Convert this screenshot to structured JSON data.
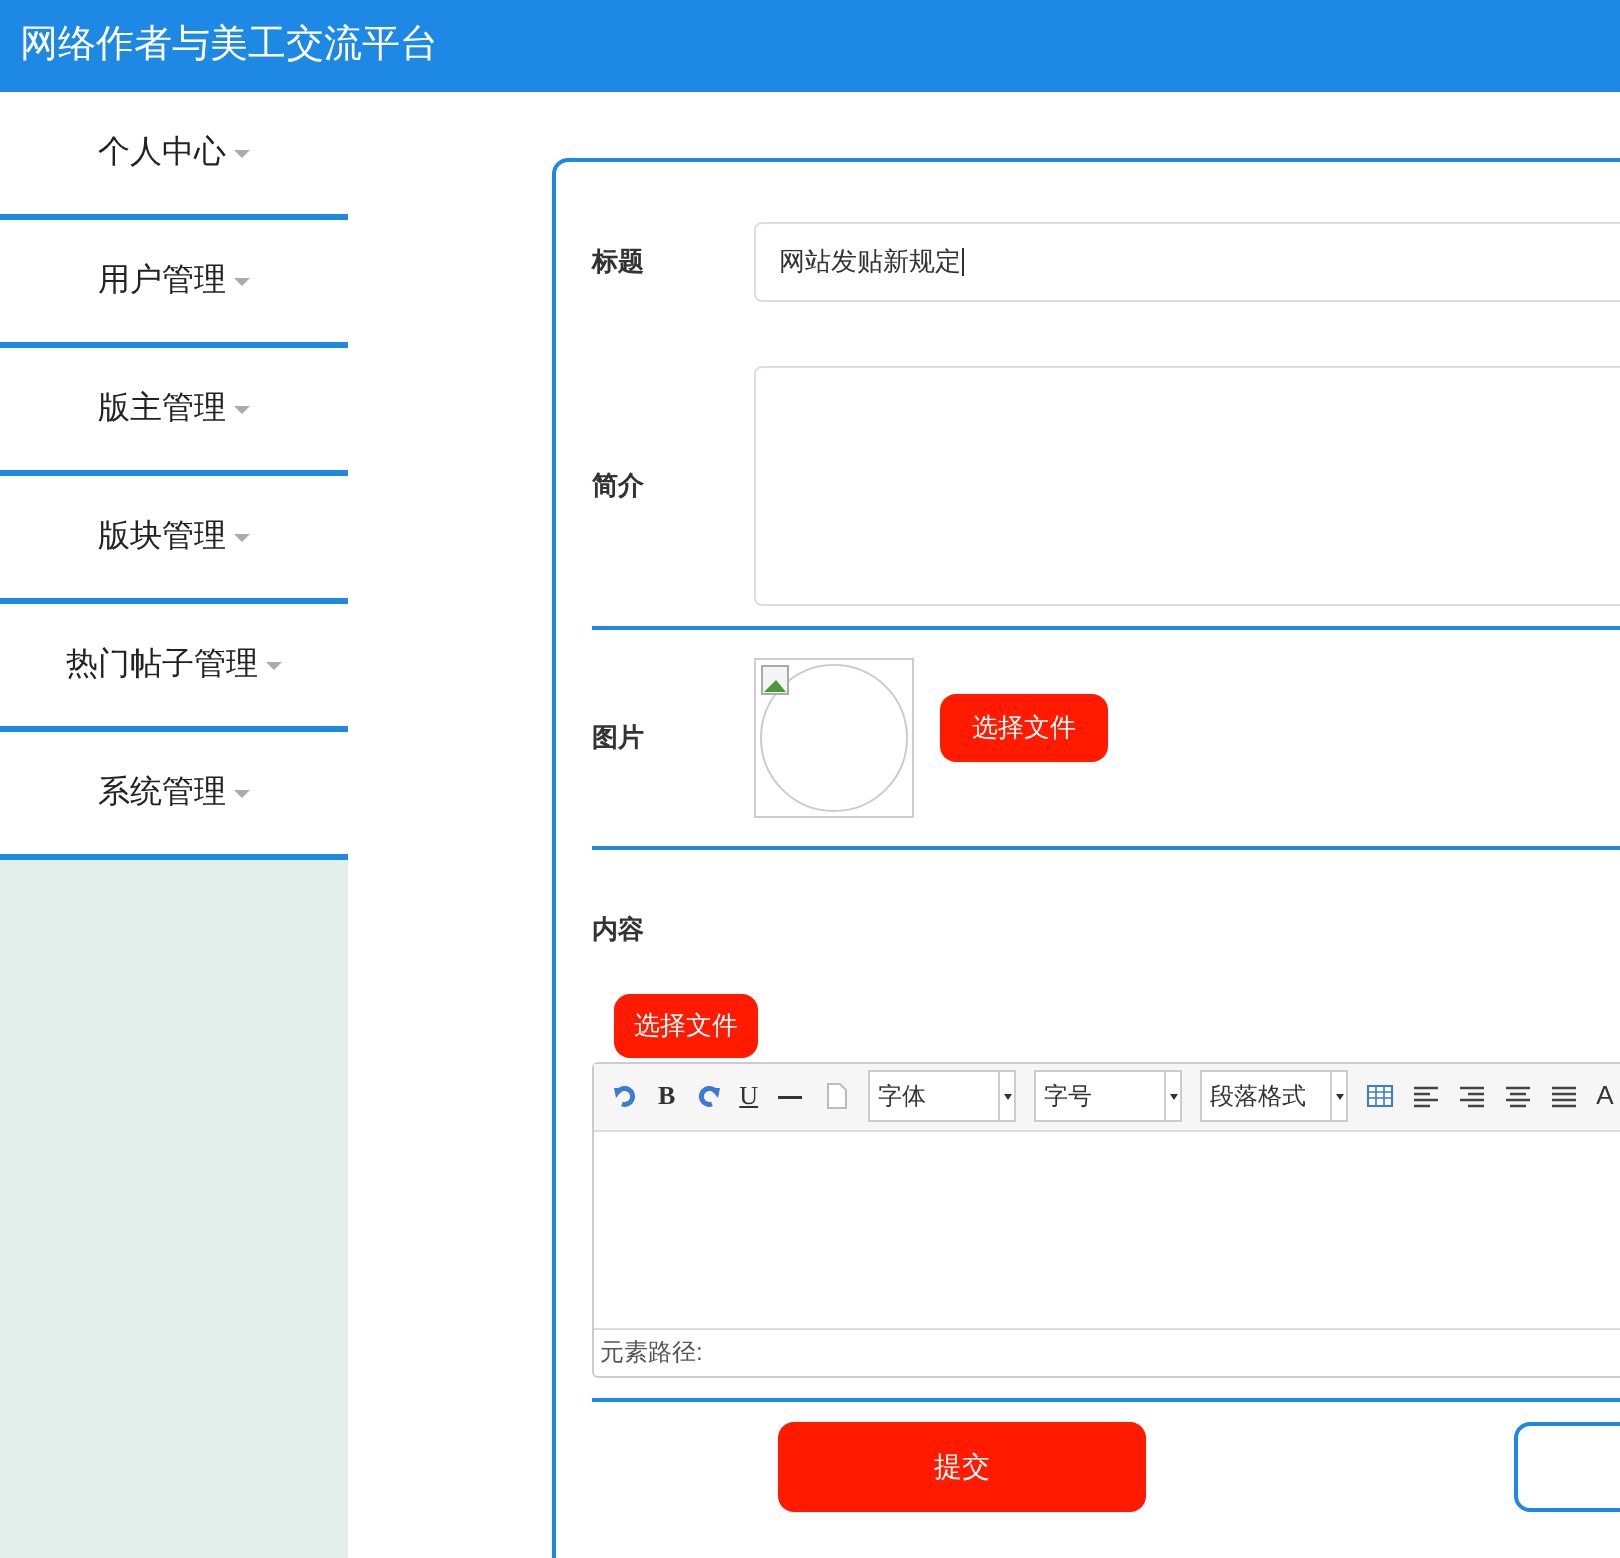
{
  "header": {
    "title": "网络作者与美工交流平台"
  },
  "sidebar": {
    "items": [
      {
        "label": "个人中心",
        "expanded": false
      },
      {
        "label": "用户管理",
        "expanded": false
      },
      {
        "label": "版主管理",
        "expanded": false
      },
      {
        "label": "版块管理",
        "expanded": false
      },
      {
        "label": "热门帖子管理",
        "expanded": false
      },
      {
        "label": "系统管理",
        "expanded": false
      }
    ]
  },
  "form": {
    "title_field": {
      "label": "标题",
      "value": "网站发贴新规定"
    },
    "intro_field": {
      "label": "简介"
    },
    "image_field": {
      "label": "图片",
      "button": "选择文件"
    },
    "content_field": {
      "label": "内容",
      "button": "选择文件",
      "toolbar": {
        "bold": "B",
        "underline": "U",
        "selects": [
          "字体",
          "字号",
          "段落格式"
        ],
        "last": "A"
      },
      "status": "元素路径:"
    },
    "submit": "提交"
  }
}
